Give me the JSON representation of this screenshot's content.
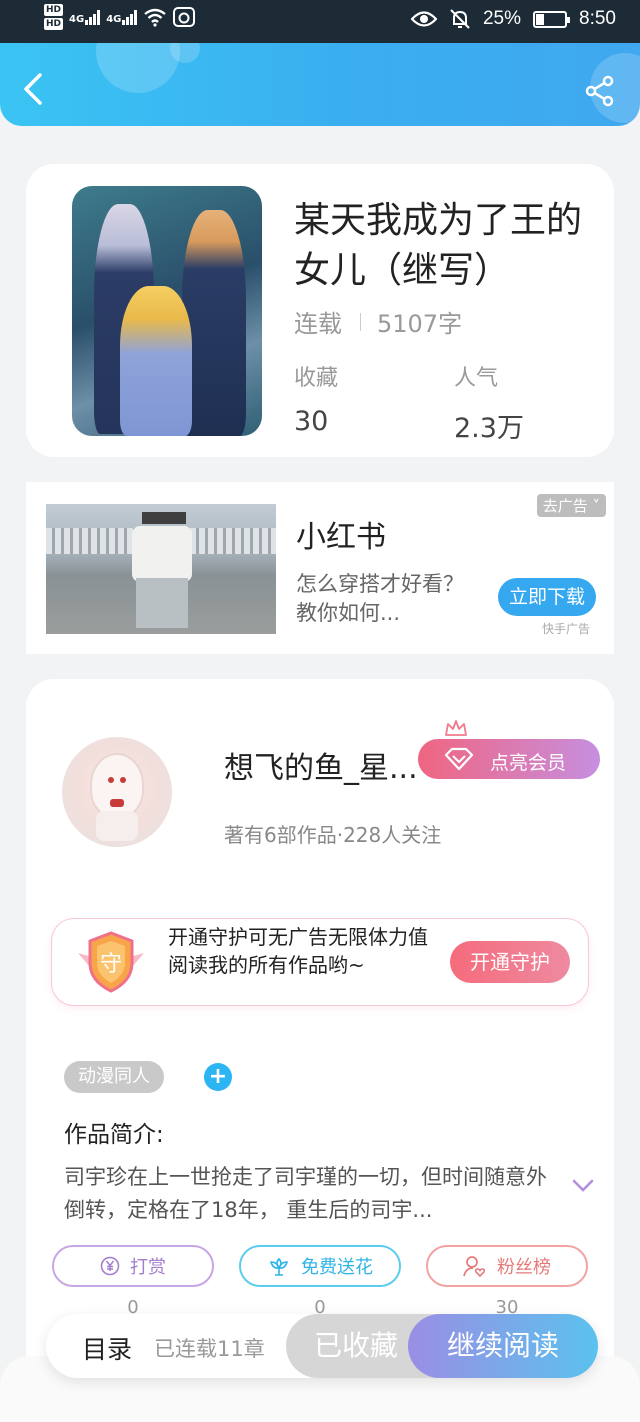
{
  "status_bar": {
    "network_1": "4G",
    "network_2": "4G",
    "hd_1": "HD",
    "hd_2": "HD",
    "battery_percent": "25%",
    "time": "8:50",
    "icons": [
      "eye-icon",
      "bell-muted-icon",
      "battery-charging-icon",
      "wifi-icon"
    ]
  },
  "header": {
    "back_icon": "chevron-left-icon",
    "share_icon": "share-icon"
  },
  "book": {
    "title": "某天我成为了王的女儿（继写）",
    "status": "连载",
    "word_count": "5107字",
    "favorites_label": "收藏",
    "favorites_value": "30",
    "popularity_label": "人气",
    "popularity_value": "2.3万"
  },
  "ad": {
    "title": "小红书",
    "description": "怎么穿搭才好看？教你如何...",
    "close_label": "去广告",
    "cta": "立即下载",
    "source": "快手广告"
  },
  "author": {
    "name": "想飞的鱼_星...",
    "stats": "著有6部作品·228人关注",
    "vip_button": "点亮会员",
    "guard_text": "开通守护可无广告无限体力值阅读我的所有作品哟~",
    "guard_badge": "守",
    "guard_button": "开通守护"
  },
  "work": {
    "tag": "动漫同人",
    "tag_add": "+",
    "intro_heading": "作品简介:",
    "intro_text": "司宇珍在上一世抢走了司宇瑾的一切，但时间随意外倒转，定格在了18年， 重生后的司宇..."
  },
  "actions": [
    {
      "label": "打赏",
      "icon": "yen-icon",
      "count": "0"
    },
    {
      "label": "免费送花",
      "icon": "flower-icon",
      "count": "0"
    },
    {
      "label": "粉丝榜",
      "icon": "user-heart-icon",
      "count": "30"
    }
  ],
  "bottom_bar": {
    "toc_label": "目录",
    "chapters": "已连载11章",
    "favorited": "已收藏",
    "continue": "继续阅读"
  },
  "colors": {
    "header_blue": "#3aaef0",
    "accent_pink": "#f06580",
    "accent_purple": "#c68fe0",
    "download_blue": "#36a8f0"
  }
}
